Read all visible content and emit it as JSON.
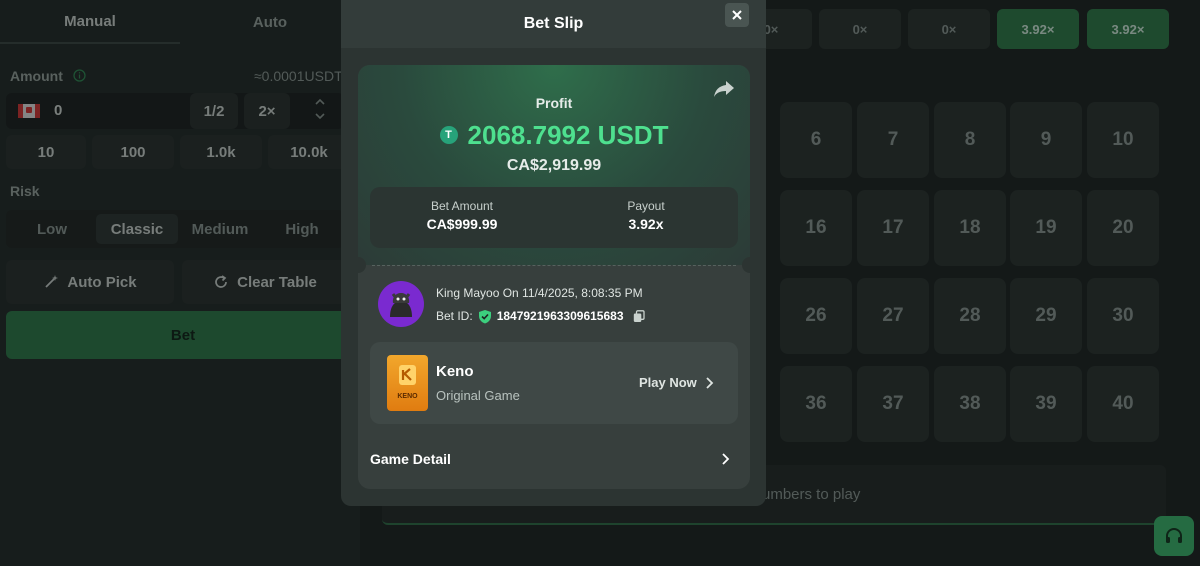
{
  "sidebar": {
    "tabs": [
      {
        "label": "Manual"
      },
      {
        "label": "Auto"
      }
    ],
    "amount_label": "Amount",
    "amount_balance": "≈0.0001USDT",
    "amount_value": "0",
    "half_label": "1/2",
    "double_label": "2×",
    "presets": [
      "10",
      "100",
      "1.0k",
      "10.0k"
    ],
    "risk_label": "Risk",
    "risk_options": [
      "Low",
      "Classic",
      "Medium",
      "High"
    ],
    "risk_selected": "Classic",
    "auto_pick_label": "Auto Pick",
    "clear_table_label": "Clear Table",
    "bet_label": "Bet"
  },
  "board": {
    "multipliers": [
      "0×",
      "0×",
      "0×",
      "3.92×",
      "3.92×"
    ],
    "tiles_row1": [
      "6",
      "7",
      "8",
      "9",
      "10"
    ],
    "tiles_row2": [
      "16",
      "17",
      "18",
      "19",
      "20"
    ],
    "tiles_row3": [
      "26",
      "27",
      "28",
      "29",
      "30"
    ],
    "tiles_row4": [
      "36",
      "37",
      "38",
      "39",
      "40"
    ],
    "hint_text": "umbers to play"
  },
  "modal": {
    "title": "Bet Slip",
    "profit_label": "Profit",
    "currency_icon_glyph": "T",
    "profit_value": "2068.7992 USDT",
    "profit_fiat": "CA$2,919.99",
    "bet_amount_label": "Bet Amount",
    "bet_amount_value": "CA$999.99",
    "payout_label": "Payout",
    "payout_value": "3.92x",
    "user_line": "King Mayoo  On 11/4/2025, 8:08:35 PM",
    "bet_id_label": "Bet ID:",
    "bet_id_value": "1847921963309615683",
    "game_thumb_text": "KENO",
    "game_name": "Keno",
    "game_category": "Original Game",
    "play_now_label": "Play Now",
    "game_detail_label": "Game Detail"
  },
  "colors": {
    "accent_green": "#4ee08f",
    "bet_button": "#2d7a4a",
    "avatar_bg": "#7a2ad0",
    "keno_orange": "#e07c10"
  },
  "icons": [
    "info-icon",
    "flag-ca-icon",
    "magic-wand-icon",
    "refresh-icon",
    "close-icon",
    "share-icon",
    "usdt-icon",
    "shield-check-icon",
    "copy-icon",
    "chevron-right-icon",
    "headset-icon"
  ]
}
